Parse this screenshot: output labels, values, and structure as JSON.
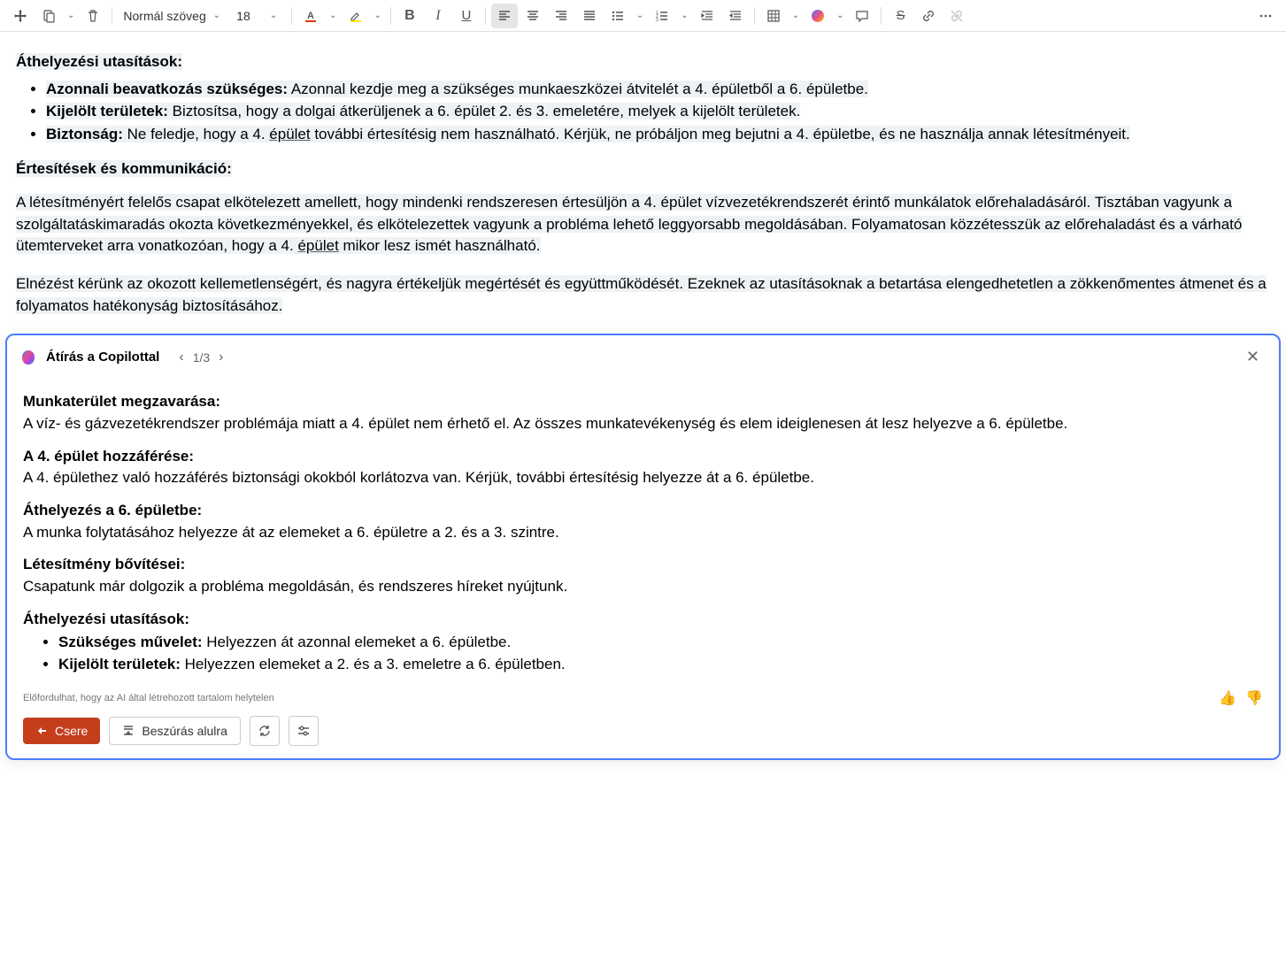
{
  "toolbar": {
    "style_label": "Normál szöveg",
    "font_size": "18"
  },
  "doc": {
    "h1": "Áthelyezési utasítások:",
    "b1_strong": "Azonnali beavatkozás szükséges:",
    "b1_text": " Azonnal kezdje meg a szükséges munkaeszközei átvitelét a 4. épületből a 6. épületbe.",
    "b2_strong": "Kijelölt területek:",
    "b2_text": " Biztosítsa, hogy a dolgai átkerüljenek a 6. épület 2. és 3. emeletére, melyek a kijelölt területek.",
    "b3_strong": "Biztonság:",
    "b3_text_a": " Ne feledje, hogy a 4. ",
    "b3_link": "épület",
    "b3_text_b": " további értesítésig nem használható. Kérjük, ne próbáljon meg bejutni a 4. épületbe, és ne használja annak létesítményeit.",
    "h2": "Értesítések és kommunikáció:",
    "p1_a": "A létesítményért felelős csapat elkötelezett amellett, hogy mindenki rendszeresen értesüljön a 4. épület vízvezetékrendszerét érintő munkálatok előrehaladásáról. Tisztában vagyunk a szolgáltatáskimaradás okozta következményekkel, és elkötelezettek vagyunk a probléma lehető leggyorsabb megoldásában. Folyamatosan közzétesszük az előrehaladást és a várható ütemterveket arra vonatkozóan, hogy a 4. ",
    "p1_link": "épület",
    "p1_b": " mikor lesz ismét használható.",
    "p2": "Elnézést kérünk az okozott kellemetlenségért, és nagyra értékeljük megértését és együttműködését. Ezeknek az utasításoknak a betartása elengedhetetlen a zökkenőmentes átmenet és a folyamatos hatékonyság biztosításához."
  },
  "copilot": {
    "title": "Átírás a Copilottal",
    "pager": "1/3",
    "disclaimer": "Előfordulhat, hogy az AI által létrehozott tartalom helytelen",
    "replace_label": "Csere",
    "insert_label": "Beszúrás alulra",
    "sections": {
      "s1h": "Munkaterület megzavarása:",
      "s1p": "A víz- és gázvezetékrendszer problémája miatt a 4. épület nem érhető el. Az összes munkatevékenység és elem ideiglenesen át lesz helyezve a 6. épületbe.",
      "s2h": "A 4. épület hozzáférése:",
      "s2p": "A 4. épülethez való hozzáférés biztonsági okokból korlátozva van. Kérjük, további értesítésig helyezze át a 6. épületbe.",
      "s3h": "Áthelyezés a 6. épületbe:",
      "s3p": "A munka folytatásához helyezze át az elemeket a 6. épületre a 2. és a 3. szintre.",
      "s4h": "Létesítmény bővítései:",
      "s4p": "Csapatunk már dolgozik a probléma megoldásán, és rendszeres híreket nyújtunk.",
      "s5h": "Áthelyezési utasítások:",
      "s5b1s": "Szükséges művelet:",
      "s5b1t": " Helyezzen át azonnal elemeket a 6. épületbe.",
      "s5b2s": "Kijelölt területek:",
      "s5b2t": " Helyezzen elemeket a 2. és a 3. emeletre a 6. épületben."
    }
  }
}
